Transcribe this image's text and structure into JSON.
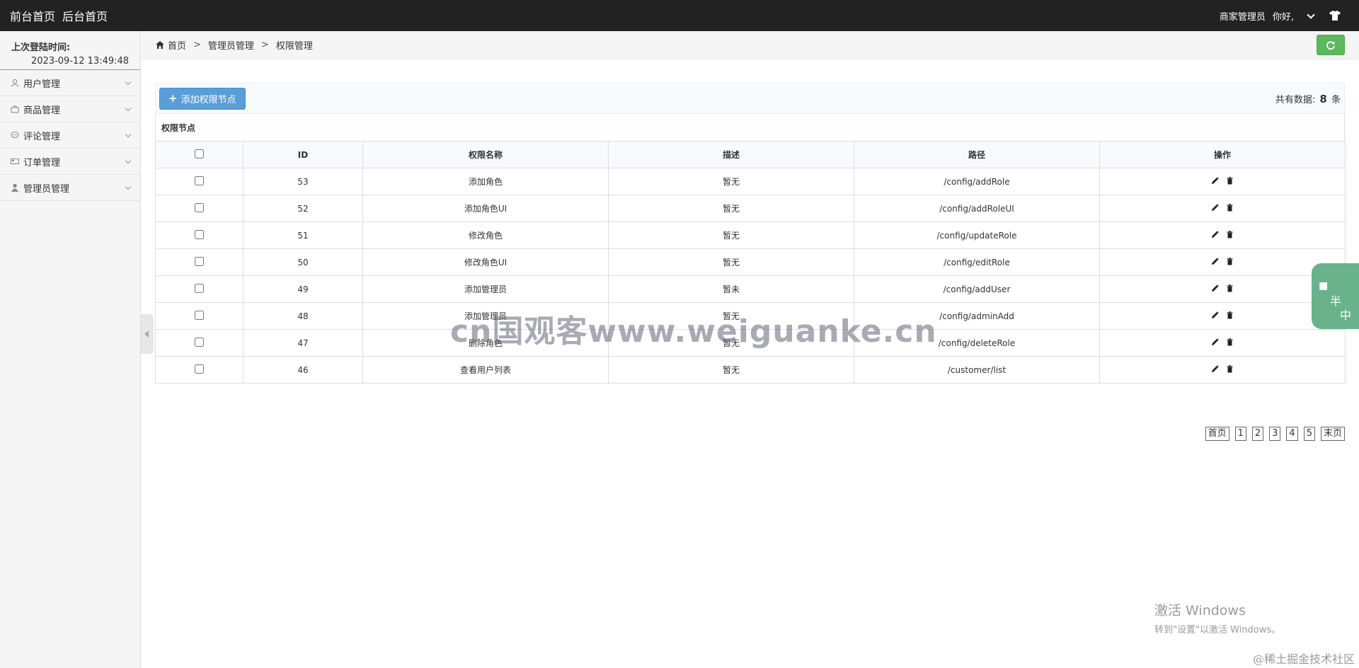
{
  "topbar": {
    "nav": [
      "前台首页",
      "后台首页"
    ],
    "user_role": "商家管理员",
    "greeting": "你好,"
  },
  "sidebar": {
    "last_login_label": "上次登陆时间:",
    "last_login_time": "2023-09-12 13:49:48",
    "items": [
      {
        "label": "用户管理",
        "icon": "user-icon"
      },
      {
        "label": "商品管理",
        "icon": "bag-icon"
      },
      {
        "label": "评论管理",
        "icon": "comment-icon"
      },
      {
        "label": "订单管理",
        "icon": "card-icon"
      },
      {
        "label": "管理员管理",
        "icon": "person-icon"
      }
    ]
  },
  "breadcrumb": [
    "首页",
    "管理员管理",
    "权限管理"
  ],
  "toolbar": {
    "add_label": "添加权限节点",
    "count_prefix": "共有数据:",
    "count_value": "8",
    "count_suffix": "条"
  },
  "table": {
    "title": "权限节点",
    "headers": [
      "ID",
      "权限名称",
      "描述",
      "路径",
      "操作"
    ],
    "rows": [
      {
        "id": "53",
        "name": "添加角色",
        "desc": "暂无",
        "path": "/config/addRole"
      },
      {
        "id": "52",
        "name": "添加角色UI",
        "desc": "暂无",
        "path": "/config/addRoleUI"
      },
      {
        "id": "51",
        "name": "修改角色",
        "desc": "暂无",
        "path": "/config/updateRole"
      },
      {
        "id": "50",
        "name": "修改角色UI",
        "desc": "暂无",
        "path": "/config/editRole"
      },
      {
        "id": "49",
        "name": "添加管理员",
        "desc": "暂未",
        "path": "/config/addUser"
      },
      {
        "id": "48",
        "name": "添加管理员",
        "desc": "暂无",
        "path": "/config/adminAdd"
      },
      {
        "id": "47",
        "name": "删除角色",
        "desc": "暂无",
        "path": "/config/deleteRole"
      },
      {
        "id": "46",
        "name": "查看用户列表",
        "desc": "暂无",
        "path": "/customer/list"
      }
    ]
  },
  "pager": [
    "首页",
    "1",
    "2",
    "3",
    "4",
    "5",
    "末页"
  ],
  "float_widget": {
    "ban": "半",
    "zhong": "中"
  },
  "watermark": "cn国观客www.weiguanke.cn",
  "windows_activation": {
    "line1": "激活 Windows",
    "line2": "转到\"设置\"以激活 Windows。"
  },
  "site_mark": "@稀土掘金技术社区",
  "colors": {
    "topbar": "#222222",
    "add_button": "#5a9ed8",
    "refresh_button": "#5cb85c"
  }
}
